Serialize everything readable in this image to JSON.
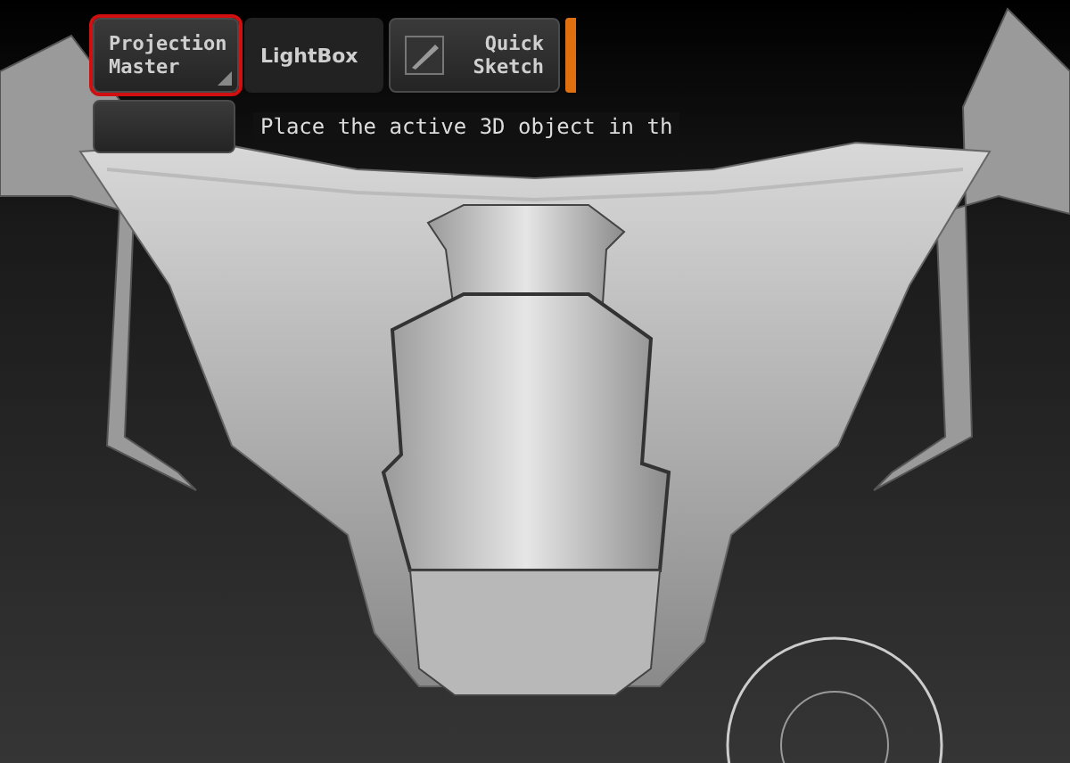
{
  "toolbar": {
    "buttons": [
      {
        "label": "Projection Master",
        "kind": "menu",
        "selected": true
      },
      {
        "label": "LightBox",
        "kind": "plain",
        "selected": false
      },
      {
        "label": "Quick Sketch",
        "kind": "icon",
        "selected": false
      }
    ]
  },
  "hint": "Place the active 3D object in th"
}
